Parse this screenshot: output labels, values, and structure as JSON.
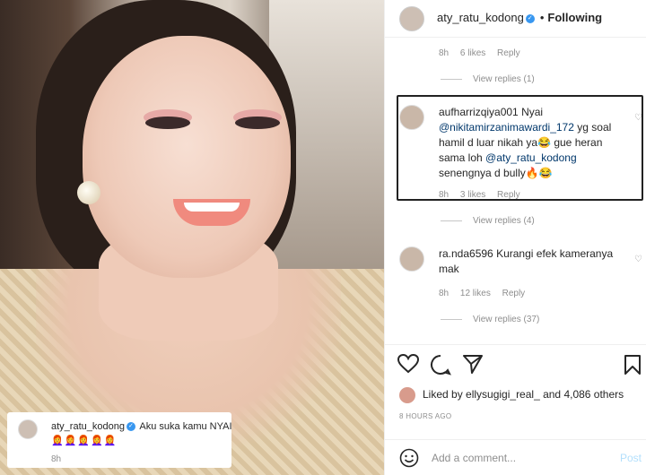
{
  "post": {
    "caption": {
      "username": "aty_ratu_kodong",
      "text": "Aku suka kamu NYAI",
      "emoji": "👩‍🦰👩‍🦰👩‍🦰👩‍🦰👩‍🦰",
      "time": "8h"
    }
  },
  "header": {
    "username": "aty_ratu_kodong",
    "separator": "•",
    "follow_label": "Following"
  },
  "top_meta": {
    "time": "8h",
    "likes": "6 likes",
    "reply": "Reply"
  },
  "view_replies_1": "View replies (1)",
  "comments": [
    {
      "username": "aufharrizqiya001",
      "text_parts": [
        "Nyai ",
        "@nikitamirzanimawardi_172",
        " yg soal hamil d luar nikah ya😂 gue heran sama loh ",
        "@aty_ratu_kodong",
        " senengnya d bully🔥😂"
      ],
      "time": "8h",
      "likes": "3 likes",
      "reply": "Reply",
      "view_replies": "View replies (4)"
    },
    {
      "username": "ra.nda6596",
      "text": "Kurangi efek kameranya mak",
      "time": "8h",
      "likes": "12 likes",
      "reply": "Reply",
      "view_replies": "View replies (37)"
    }
  ],
  "likes_line": {
    "prefix": "Liked by ",
    "user": "ellysugigi_real_",
    "suffix": " and 4,086 others"
  },
  "time_ago": "8 HOURS AGO",
  "add_comment": {
    "placeholder": "Add a comment...",
    "post_label": "Post"
  },
  "icons": [
    "heart-icon",
    "comment-icon",
    "share-icon",
    "bookmark-icon",
    "emoji-icon",
    "verified-icon"
  ],
  "colors": {
    "verified": "#3897f0",
    "mention": "#00376b",
    "muted": "#8e8e8e",
    "post_disabled": "#b2dffc"
  }
}
